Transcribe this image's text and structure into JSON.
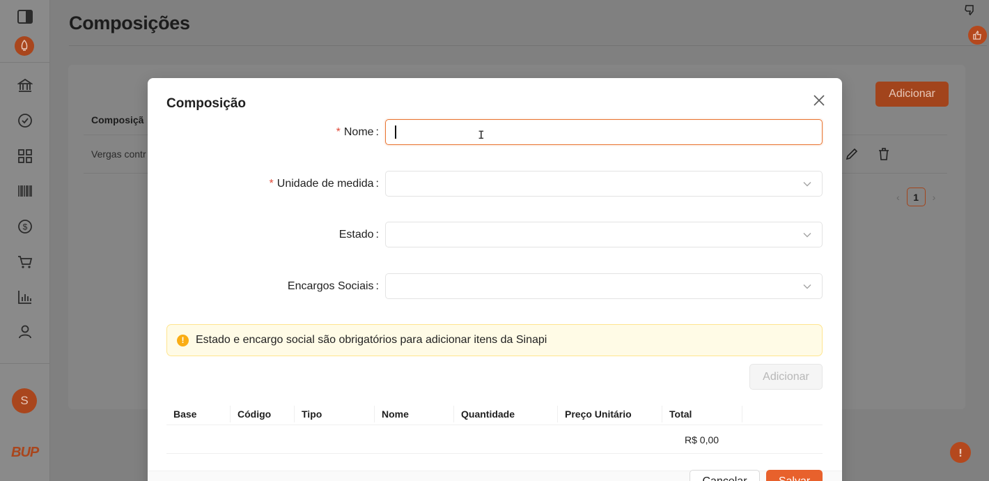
{
  "page": {
    "title": "Composições",
    "add_button": "Adicionar",
    "table": {
      "column_header": "Composiçã",
      "row_text": "Vergas contr"
    },
    "pagination": {
      "current": "1"
    }
  },
  "sidebar": {
    "avatar_initial": "S",
    "logo_text": "BUP",
    "icons": [
      "panel-toggle-icon",
      "rocket-icon",
      "bank-icon",
      "check-circle-icon",
      "grid-icon",
      "barcode-icon",
      "dollar-icon",
      "cart-icon",
      "bar-chart-icon",
      "user-icon"
    ]
  },
  "modal": {
    "title": "Composição",
    "fields": {
      "nome": {
        "label": "Nome",
        "value": ""
      },
      "unidade": {
        "label": "Unidade de medida",
        "value": ""
      },
      "estado": {
        "label": "Estado",
        "value": ""
      },
      "encargos": {
        "label": "Encargos Sociais",
        "value": ""
      }
    },
    "colon": ":",
    "required_mark": "*",
    "alert": {
      "icon": "!",
      "text": "Estado e encargo social são obrigatórios para adicionar itens da Sinapi"
    },
    "add_button": "Adicionar",
    "table": {
      "columns": [
        "Base",
        "Código",
        "Tipo",
        "Nome",
        "Quantidade",
        "Preço Unitário",
        "Total"
      ],
      "total_value": "R$ 0,00"
    },
    "footer": {
      "cancel_label": "Cancelar",
      "save_label": "Salvar"
    }
  },
  "colors": {
    "accent": "#e8612c",
    "focus_border": "#e8732f",
    "warning_bg": "#fffbe6",
    "warning_border": "#ffe58f",
    "warning_icon": "#faad14",
    "required": "#e14b3a"
  }
}
